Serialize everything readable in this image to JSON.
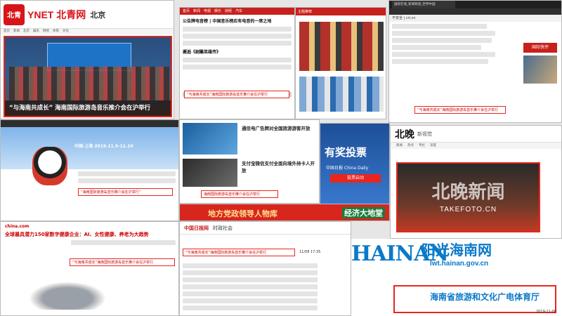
{
  "p1": {
    "logo_text": "北青",
    "brand": "YNET 北青网",
    "city": "北京",
    "nav": [
      "首页",
      "新闻",
      "北京",
      "娱乐",
      "财经",
      "体育",
      "文化"
    ],
    "caption": "“与海南共成长” 海南国际旅游岛音乐推介会在沪举行"
  },
  "p2": {
    "nav": [
      "首页",
      "新闻",
      "电视",
      "娱乐",
      "财经",
      "汽车"
    ],
    "headline1": "公告牌电音榜 | 中国音乐榜应有电音的一席之地",
    "headline2": "邂逅《剧雕英雄传》",
    "highlight": "“与海南共成长”海南国际旅游岛音乐推介会在沪举行"
  },
  "p3": {
    "banner": "主题推荐"
  },
  "p4": {
    "tab": "国际在线_新闻频道_世界中国",
    "url": "不安全 | cri.cn",
    "badge": "国际快评",
    "highlight": "“与海南共成长”海南国际旅游岛音乐推介会在沪举行"
  },
  "p5": {
    "date": "中国·上海 2019.11.5-11.10",
    "highlight": "“海南国际旅游岛音乐推介会在沪举行”"
  },
  "p6": {
    "headline1": "通信电广告牌对全国旅游游客开放",
    "headline2": "支付宝微信支付全面向境外持卡人开放",
    "highlight": "海南国际旅游岛音乐推介会在沪举行"
  },
  "p7": {
    "title": "有奖投票",
    "sub": "中国日报 China Daily",
    "btn": "投票启动"
  },
  "p8": {
    "logo": "北晚",
    "subtitle": "新视觉",
    "nav": [
      "新闻",
      "热点",
      "专栏",
      "深度"
    ],
    "wm": "北晚新闻",
    "wm2": "TAKEFOTO.CN"
  },
  "p9": {
    "title": "地方党政领导人物库",
    "tag": "经济大地堂"
  },
  "p10": {
    "logo": "china.com",
    "headline": "全球最具潜力150家数字健康企业：AI、女性健康、养老为大趋势",
    "highlight": "“与海南共成长”海南国际旅游岛音乐推介会在沪举行"
  },
  "p11": {
    "logo": "中国日报网",
    "section": "时政社会",
    "highlight": "“与海南共成长”海南国际旅游岛音乐推介会在沪举行",
    "date": "11/08 17:35"
  },
  "p12": {
    "hainan": "HAINAN",
    "sunny": "阳光海南网",
    "url": "lwt.hainan.gov.cn",
    "bureau": "海南省旅游和文化广电体育厅",
    "date": "2019-11-08"
  }
}
